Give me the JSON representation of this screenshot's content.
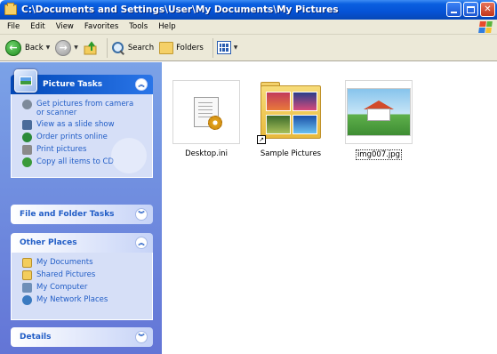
{
  "window": {
    "title": "C:\\Documents and Settings\\User\\My Documents\\My Pictures"
  },
  "menu": [
    "File",
    "Edit",
    "View",
    "Favorites",
    "Tools",
    "Help"
  ],
  "toolbar": {
    "back_label": "Back",
    "search_label": "Search",
    "folders_label": "Folders"
  },
  "sidebar": {
    "picture_tasks": {
      "title": "Picture Tasks",
      "items": [
        "Get pictures from camera or scanner",
        "View as a slide show",
        "Order prints online",
        "Print pictures",
        "Copy all items to CD"
      ]
    },
    "file_folder_tasks": {
      "title": "File and Folder Tasks"
    },
    "other_places": {
      "title": "Other Places",
      "items": [
        "My Documents",
        "Shared Pictures",
        "My Computer",
        "My Network Places"
      ]
    },
    "details": {
      "title": "Details"
    }
  },
  "files": [
    {
      "name": "Desktop.ini",
      "icon": "ini-file-icon"
    },
    {
      "name": "Sample Pictures",
      "icon": "folder-shortcut-icon"
    },
    {
      "name": "img007.jpg",
      "icon": "image-thumbnail",
      "selected": true
    }
  ],
  "colors": {
    "titlebar": "#0553d6",
    "sidebar_bg": "#7ba2e7",
    "link": "#215dc6",
    "panel_body": "#d6dff7"
  }
}
